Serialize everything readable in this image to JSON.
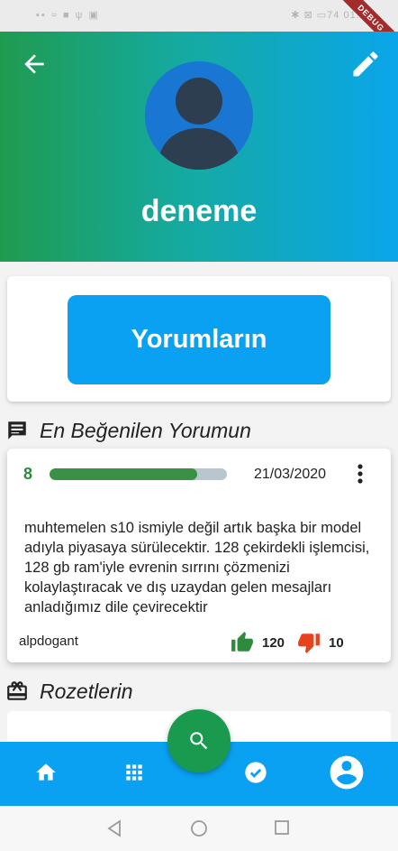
{
  "status_bar": {
    "left_icons": "▪▪ ≈ ■ ψ ▣",
    "right_text": "✱ ⊠ ▭74 01:08"
  },
  "debug_label": "DEBUG",
  "profile": {
    "username": "deneme"
  },
  "comments_button": {
    "label": "Yorumların"
  },
  "top_comment_section": {
    "title": "En Beğenilen Yorumun"
  },
  "top_comment": {
    "score": "8",
    "progress": 0.83,
    "date": "21/03/2020",
    "text": "muhtemelen s10 ismiyle değil artık başka bir model adıyla piyasaya sürülecektir. 128 çekirdekli işlemcisi, 128 gb ram'iyle evrenin sırrını çözmenizi kolaylaştıracak ve dış uzaydan gelen mesajları anladığımız dile çevirecektir",
    "author": "alpdogant",
    "likes": "120",
    "dislikes": "10"
  },
  "badges_section": {
    "title": "Rozetlerin"
  },
  "colors": {
    "header_gradient_start": "#1f9b50",
    "header_gradient_end": "#0aa6ea",
    "primary_blue": "#0aa1f2",
    "fab_green": "#1a9a4e",
    "like_green": "#2e8b3e",
    "dislike_red": "#e8421c"
  },
  "icons": [
    "arrow-back-icon",
    "edit-icon",
    "person-icon",
    "comment-icon",
    "more-vert-icon",
    "thumb-up-icon",
    "thumb-down-icon",
    "badge-icon",
    "search-icon",
    "home-icon",
    "apps-icon",
    "check-circle-icon",
    "account-circle-icon",
    "back-triangle-icon",
    "home-circle-icon",
    "recents-square-icon"
  ]
}
